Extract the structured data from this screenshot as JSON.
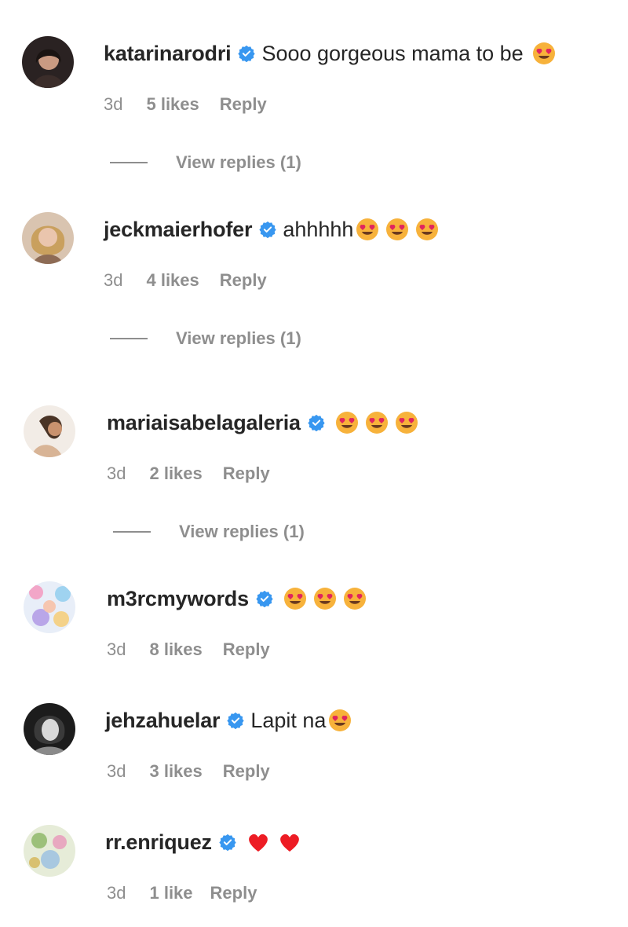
{
  "colors": {
    "username": "#262626",
    "meta": "#8e8e8e",
    "verified": "#3897f0",
    "heart": "#ed1c24"
  },
  "comments": [
    {
      "username": "katarinarodri",
      "text": "Sooo gorgeous mama to be",
      "emojis": [
        "heart-eyes-emoji"
      ],
      "time": "3d",
      "likes": "5 likes",
      "reply": "Reply",
      "view_replies": "View replies (1)"
    },
    {
      "username": "jeckmaierhofer",
      "text": "ahhhhh",
      "emojis": [
        "heart-eyes-emoji",
        "heart-eyes-emoji",
        "heart-eyes-emoji"
      ],
      "time": "3d",
      "likes": "4 likes",
      "reply": "Reply",
      "view_replies": "View replies (1)"
    },
    {
      "username": "mariaisabelagaleria",
      "text": "",
      "emojis": [
        "heart-eyes-emoji",
        "heart-eyes-emoji",
        "heart-eyes-emoji"
      ],
      "time": "3d",
      "likes": "2 likes",
      "reply": "Reply",
      "view_replies": "View replies (1)"
    },
    {
      "username": "m3rcmywords",
      "text": "",
      "emojis": [
        "heart-eyes-emoji",
        "heart-eyes-emoji",
        "heart-eyes-emoji"
      ],
      "time": "3d",
      "likes": "8 likes",
      "reply": "Reply"
    },
    {
      "username": "jehzahuelar",
      "text": "Lapit na",
      "emojis": [
        "heart-eyes-emoji"
      ],
      "time": "3d",
      "likes": "3 likes",
      "reply": "Reply"
    },
    {
      "username": "rr.enriquez",
      "text": "",
      "emojis": [
        "red-heart-emoji",
        "red-heart-emoji"
      ],
      "time": "3d",
      "likes": "1 like",
      "reply": "Reply"
    }
  ]
}
